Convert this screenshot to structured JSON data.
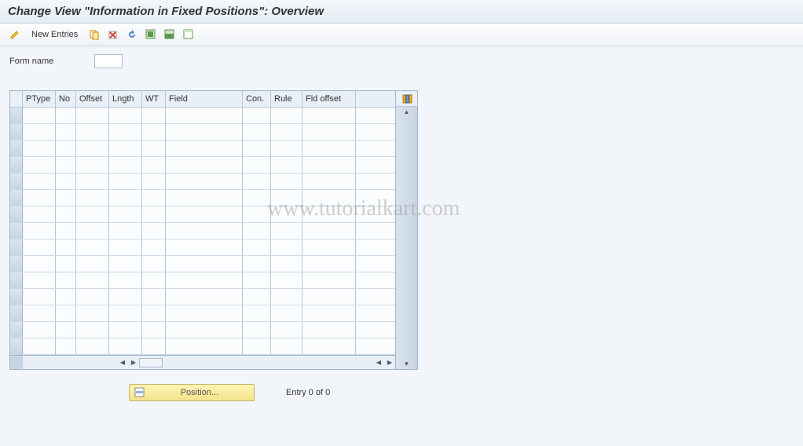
{
  "header": {
    "title": "Change View \"Information in Fixed Positions\": Overview"
  },
  "toolbar": {
    "new_entries_label": "New Entries"
  },
  "form": {
    "name_label": "Form name",
    "name_value": ""
  },
  "table": {
    "columns": {
      "ptype": "PType",
      "no": "No",
      "offset": "Offset",
      "length": "Lngth",
      "wt": "WT",
      "field": "Field",
      "con": "Con.",
      "rule": "Rule",
      "fldoffset": "Fld offset"
    },
    "row_count": 15
  },
  "footer": {
    "position_label": "Position...",
    "entry_label": "Entry 0 of 0"
  },
  "watermark": "www.tutorialkart.com"
}
